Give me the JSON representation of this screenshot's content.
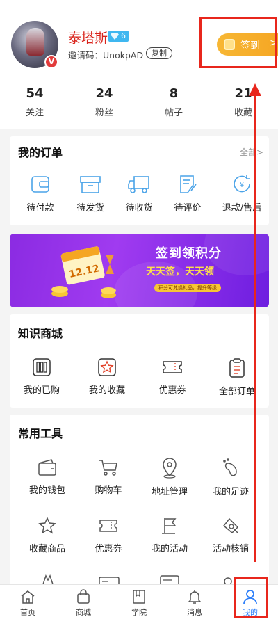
{
  "profile": {
    "username": "泰塔斯",
    "level": "6",
    "invite_text": "邀请码：UnokpAD",
    "copy_label": "复制",
    "signin_label": "签到",
    "signin_chevron": ">",
    "verified_badge": "V",
    "stats": [
      {
        "num": "54",
        "label": "关注"
      },
      {
        "num": "24",
        "label": "粉丝"
      },
      {
        "num": "8",
        "label": "帖子"
      },
      {
        "num": "21",
        "label": "收藏"
      }
    ]
  },
  "orders": {
    "title": "我的订单",
    "more": "全部>",
    "items": [
      {
        "label": "待付款",
        "icon": "wallet-icon"
      },
      {
        "label": "待发货",
        "icon": "box-icon"
      },
      {
        "label": "待收货",
        "icon": "truck-icon"
      },
      {
        "label": "待评价",
        "icon": "review-icon"
      },
      {
        "label": "退款/售后",
        "icon": "refund-icon"
      }
    ]
  },
  "banner": {
    "title": "签到领积分",
    "subtitle": "天天签，天天领",
    "note": "积分可兑换礼品，提升等级",
    "calendar_text": "12.12"
  },
  "knowledge_shop": {
    "title": "知识商城",
    "items": [
      {
        "label": "我的已购",
        "icon": "purchased-icon"
      },
      {
        "label": "我的收藏",
        "icon": "favorite-star-icon"
      },
      {
        "label": "优惠券",
        "icon": "coupon-icon"
      },
      {
        "label": "全部订单",
        "icon": "order-list-icon"
      }
    ]
  },
  "tools": {
    "title": "常用工具",
    "items": [
      {
        "label": "我的钱包",
        "icon": "wallet-icon"
      },
      {
        "label": "购物车",
        "icon": "cart-icon"
      },
      {
        "label": "地址管理",
        "icon": "location-icon"
      },
      {
        "label": "我的足迹",
        "icon": "footprint-icon"
      },
      {
        "label": "收藏商品",
        "icon": "star-icon"
      },
      {
        "label": "优惠券",
        "icon": "ticket-icon"
      },
      {
        "label": "我的活动",
        "icon": "flag-icon"
      },
      {
        "label": "活动核销",
        "icon": "verify-icon"
      }
    ]
  },
  "tabbar": {
    "items": [
      {
        "label": "首页",
        "icon": "home-icon"
      },
      {
        "label": "商城",
        "icon": "shop-bag-icon"
      },
      {
        "label": "学院",
        "icon": "book-icon"
      },
      {
        "label": "消息",
        "icon": "bell-icon"
      },
      {
        "label": "我的",
        "icon": "user-icon",
        "active": true
      }
    ]
  },
  "colors": {
    "accent_red": "#d9241c",
    "icon_blue": "#4aa3e8",
    "signin_gold": "#f5a623",
    "tab_active": "#2d7ff9",
    "banner_purple": "#8b2be2"
  }
}
